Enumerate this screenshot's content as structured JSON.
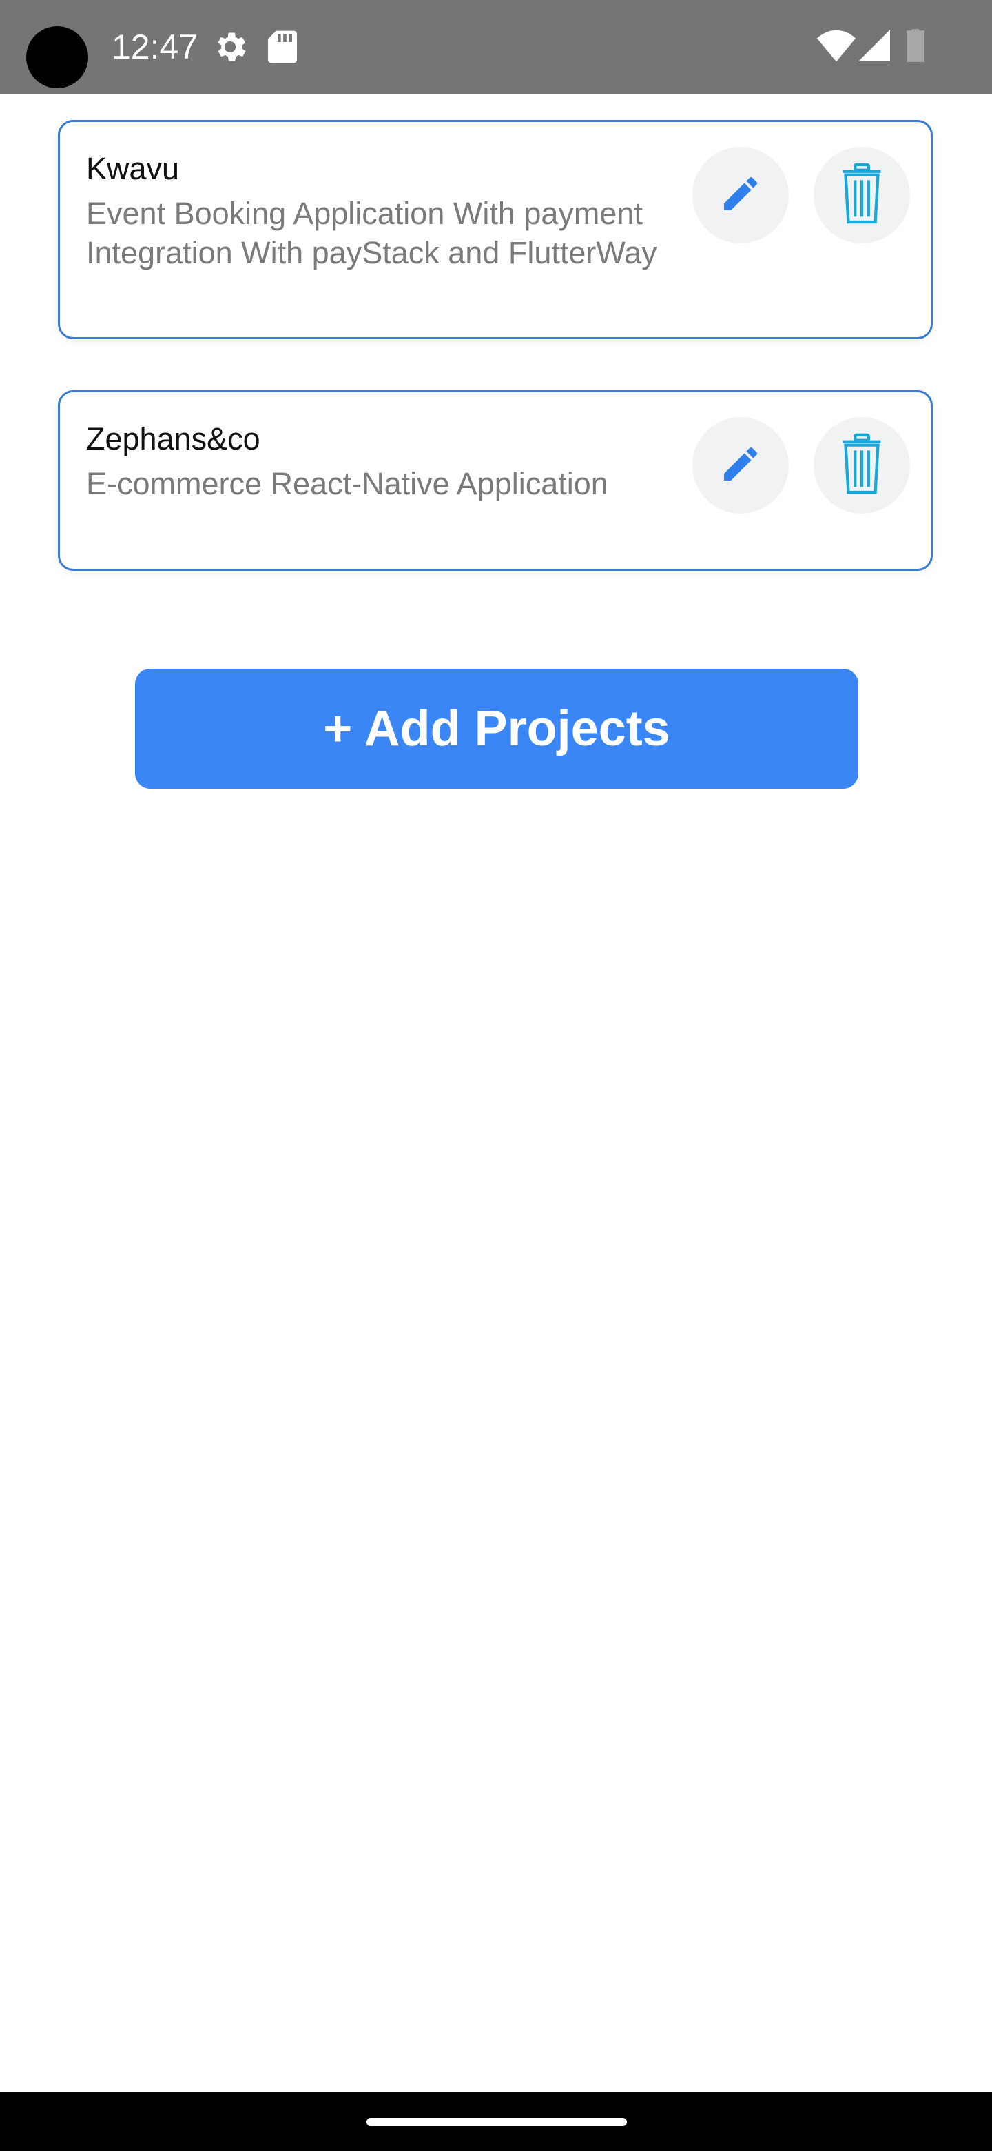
{
  "status_bar": {
    "time": "12:47",
    "icons": [
      "settings-gear-icon",
      "sd-card-icon",
      "wifi-icon",
      "cellular-signal-icon",
      "battery-icon"
    ]
  },
  "projects": [
    {
      "title": "Kwavu",
      "description": "Event Booking Application With payment Integration With payStack and FlutterWay"
    },
    {
      "title": "Zephans&co",
      "description": "E-commerce React-Native Application"
    }
  ],
  "actions": {
    "edit_icon": "pencil-icon",
    "delete_icon": "trash-icon",
    "add_label": "+ Add Projects"
  },
  "colors": {
    "accent": "#3b86f5",
    "card_border": "#3a7bd5",
    "edit_icon": "#2f80ed",
    "delete_icon": "#19a7d8",
    "status_bar": "#757575"
  }
}
